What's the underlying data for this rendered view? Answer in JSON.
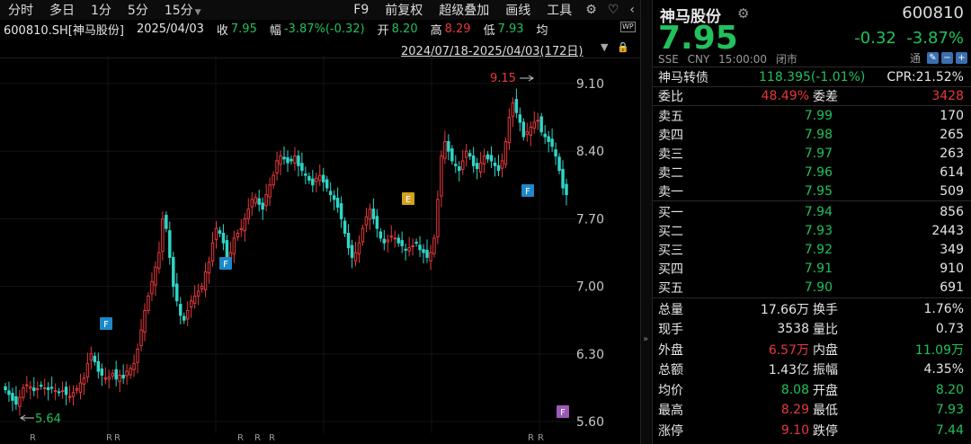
{
  "toolbar": {
    "periods": [
      "分时",
      "多日",
      "1分",
      "5分",
      "15分"
    ],
    "tools": [
      "F9",
      "前复权",
      "超级叠加",
      "画线",
      "工具"
    ],
    "settings_icon": "gear-icon",
    "favorite_icon": "heart-icon",
    "more_icon": "chevron-left-icon"
  },
  "infoline": {
    "symbol": "600810.SH[神马股份]",
    "date": "2025/04/03",
    "close_label": "收",
    "close": "7.95",
    "change_label": "幅",
    "change": "-3.87%(-0.32)",
    "open_label": "开",
    "open": "8.20",
    "high_label": "高",
    "high": "8.29",
    "low_label": "低",
    "low": "7.93",
    "avg_label": "均",
    "range": "2024/07/18-2025/04/03(172日)",
    "wp_badge": "WP"
  },
  "chart_data": {
    "type": "candlestick",
    "y_ticks": [
      "9.10",
      "8.40",
      "7.70",
      "7.00",
      "6.30",
      "5.60"
    ],
    "ylim": [
      5.6,
      9.1
    ],
    "annotations": {
      "max_label": "9.15",
      "min_label": "5.64",
      "markers": [
        {
          "text": "F",
          "color": "#1e88c8"
        },
        {
          "text": "F",
          "color": "#1e88c8"
        },
        {
          "text": "E",
          "color": "#d4a020"
        },
        {
          "text": "F",
          "color": "#1e88c8"
        },
        {
          "text": "F",
          "color": "#9b59b6"
        }
      ],
      "r_labels": [
        "R",
        "R",
        "R",
        "R",
        "R",
        "R",
        "R",
        "R"
      ]
    },
    "colors": {
      "up": "#e8383d",
      "down": "#2ed6c8"
    }
  },
  "panel": {
    "name": "神马股份",
    "code": "600810",
    "price": "7.95",
    "change": "-0.32",
    "change_pct": "-3.87%",
    "exchange": "SSE",
    "currency": "CNY",
    "time": "15:00:00",
    "status": "闭市",
    "tong_label": "通",
    "tong_icon": "tong-icon",
    "bond": {
      "label": "神马转债",
      "value": "118.395(-1.01%)",
      "cpr": "CPR:21.52%"
    },
    "webi": {
      "label": "委比",
      "value": "48.49%",
      "diff_label": "委差",
      "diff": "3428"
    },
    "asks": [
      {
        "label": "卖五",
        "price": "7.99",
        "vol": "170"
      },
      {
        "label": "卖四",
        "price": "7.98",
        "vol": "265"
      },
      {
        "label": "卖三",
        "price": "7.97",
        "vol": "263"
      },
      {
        "label": "卖二",
        "price": "7.96",
        "vol": "614"
      },
      {
        "label": "卖一",
        "price": "7.95",
        "vol": "509"
      }
    ],
    "bids": [
      {
        "label": "买一",
        "price": "7.94",
        "vol": "856"
      },
      {
        "label": "买二",
        "price": "7.93",
        "vol": "2443"
      },
      {
        "label": "买三",
        "price": "7.92",
        "vol": "349"
      },
      {
        "label": "买四",
        "price": "7.91",
        "vol": "910"
      },
      {
        "label": "买五",
        "price": "7.90",
        "vol": "691"
      }
    ],
    "stats": [
      [
        {
          "label": "总量",
          "value": "17.66万",
          "color": "white"
        },
        {
          "label": "换手",
          "value": "1.76%",
          "color": "white"
        }
      ],
      [
        {
          "label": "现手",
          "value": "3538",
          "color": "white"
        },
        {
          "label": "量比",
          "value": "0.73",
          "color": "white"
        }
      ],
      [
        {
          "label": "外盘",
          "value": "6.57万",
          "color": "up"
        },
        {
          "label": "内盘",
          "value": "11.09万",
          "color": "down"
        }
      ],
      [
        {
          "label": "总额",
          "value": "1.43亿",
          "color": "white"
        },
        {
          "label": "振幅",
          "value": "4.35%",
          "color": "white"
        }
      ],
      [
        {
          "label": "均价",
          "value": "8.08",
          "color": "down"
        },
        {
          "label": "开盘",
          "value": "8.20",
          "color": "down"
        }
      ],
      [
        {
          "label": "最高",
          "value": "8.29",
          "color": "up"
        },
        {
          "label": "最低",
          "value": "7.93",
          "color": "down"
        }
      ],
      [
        {
          "label": "涨停",
          "value": "9.10",
          "color": "up"
        },
        {
          "label": "跌停",
          "value": "7.44",
          "color": "down"
        }
      ]
    ]
  }
}
